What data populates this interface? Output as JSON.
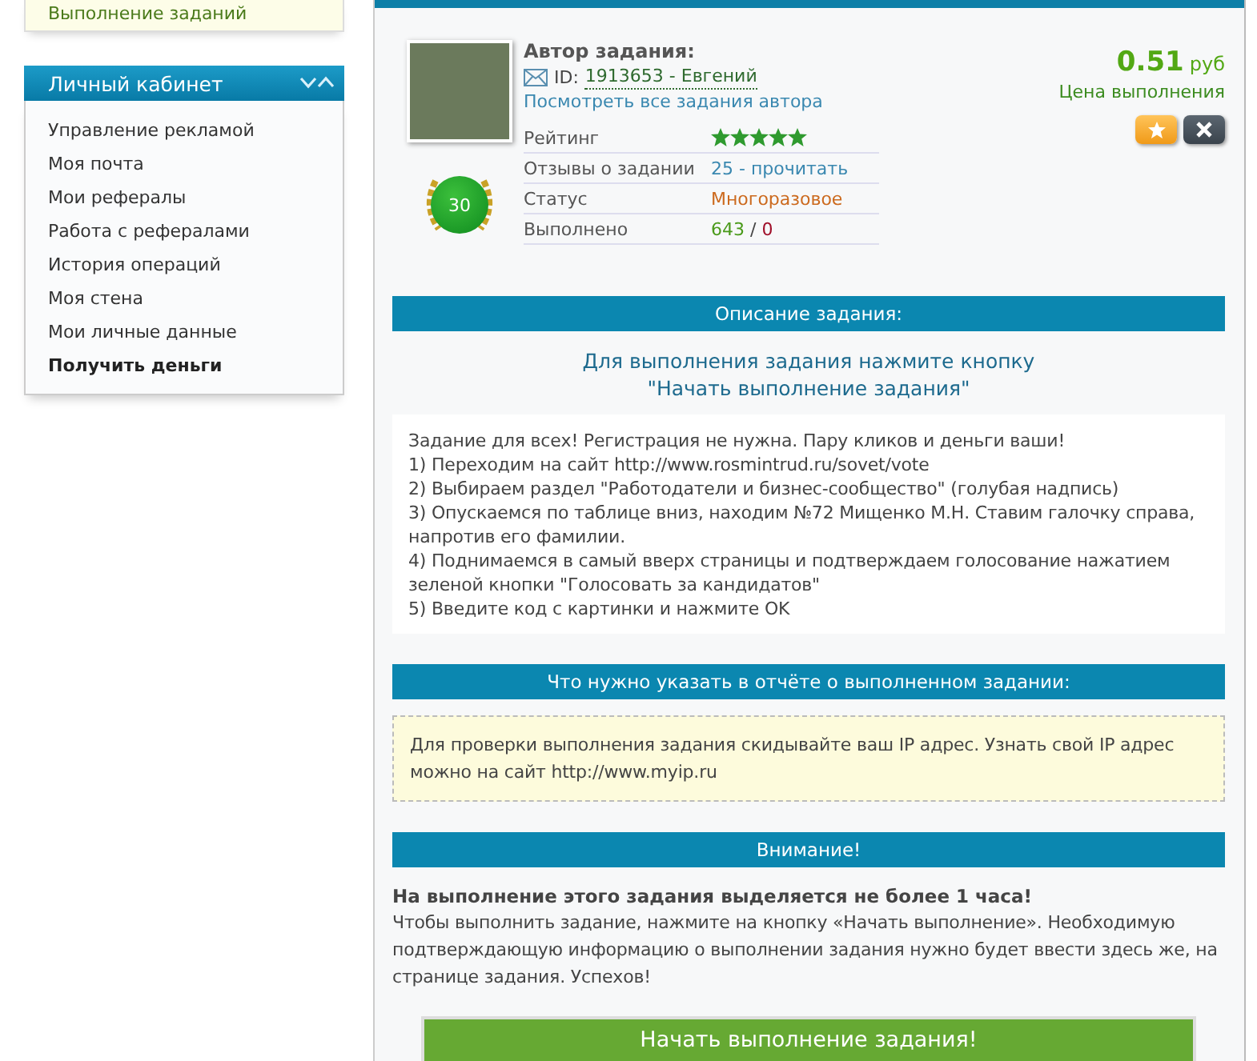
{
  "sidebar": {
    "top_item": "Выполнение заданий",
    "section_title": "Личный кабинет",
    "items": [
      {
        "label": "Управление рекламой",
        "highlighted": false
      },
      {
        "label": "Моя почта",
        "highlighted": false
      },
      {
        "label": "Мои рефералы",
        "highlighted": false
      },
      {
        "label": "Работа с рефералами",
        "highlighted": false
      },
      {
        "label": "История операций",
        "highlighted": false
      },
      {
        "label": "Моя стена",
        "highlighted": false
      },
      {
        "label": "Мои личные данные",
        "highlighted": false
      },
      {
        "label": "Получить деньги",
        "highlighted": true
      }
    ]
  },
  "author": {
    "heading": "Автор задания:",
    "id_label": "ID:",
    "id_link": "1913653 - Евгений",
    "all_tasks_link": "Посмотреть все задания автора",
    "level_badge": "30",
    "stats": [
      {
        "label": "Рейтинг",
        "kind": "stars",
        "stars": 5
      },
      {
        "label": "Отзывы о задании",
        "kind": "link",
        "value": "25 - прочитать"
      },
      {
        "label": "Статус",
        "kind": "status",
        "value": "Многоразовое"
      },
      {
        "label": "Выполнено",
        "kind": "counts",
        "done": "643",
        "separator": "/",
        "failed": "0"
      }
    ]
  },
  "price": {
    "amount": "0.51",
    "currency": "руб",
    "label": "Цена выполнения"
  },
  "description": {
    "header": "Описание задания:",
    "title_lines": [
      "Для выполнения задания нажмите кнопку",
      "\"Начать выполнение задания\""
    ],
    "lines": [
      "Задание для всех! Регистрация не нужна. Пару кликов и деньги ваши!",
      "1) Переходим на сайт http://www.rosmintrud.ru/sovet/vote",
      "2) Выбираем раздел \"Работодатели и бизнес-сообщество\" (голубая надпись)",
      "3) Опускаемся по таблице вниз, находим №72 Мищенко М.Н. Ставим галочку справа, напротив его фамилии.",
      "4) Поднимаемся в самый вверх страницы и подтверждаем голосование нажатием зеленой кнопки \"Голосовать за кандидатов\"",
      "5) Введите код с картинки и нажмите OK"
    ]
  },
  "report": {
    "header": "Что нужно указать в отчёте о выполненном задании:",
    "text": "Для проверки выполнения задания скидывайте ваш IP адрес. Узнать свой IP адрес можно на сайт http://www.myip.ru"
  },
  "attention": {
    "header": "Внимание!",
    "warning": "На выполнение этого задания выделяется не более 1 часа!",
    "text": "Чтобы выполнить задание, нажмите на кнопку «Начать выполнение». Необходимую подтверждающую информацию о выполнении задания нужно будет ввести здесь же, на странице задания. Успехов!"
  },
  "start_button": "Начать выполнение задания!"
}
